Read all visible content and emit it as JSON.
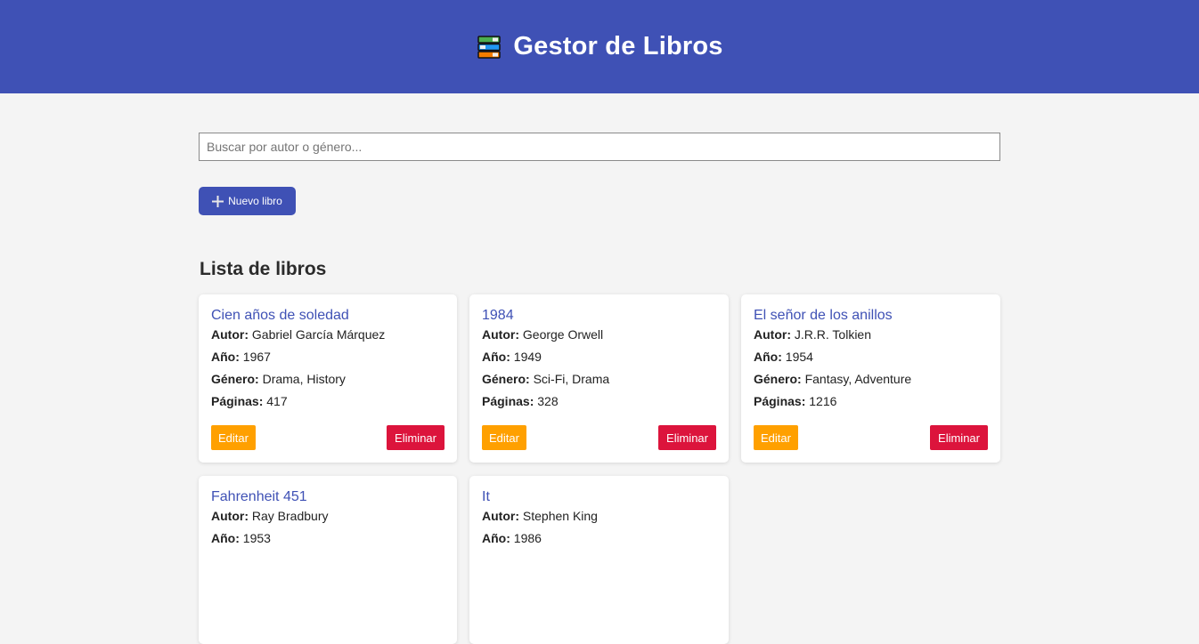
{
  "header": {
    "icon": "books-icon",
    "title": "Gestor de Libros"
  },
  "search": {
    "placeholder": "Buscar por autor o género...",
    "value": ""
  },
  "new_book_button": {
    "icon": "plus-icon",
    "label": "Nuevo libro"
  },
  "list_title": "Lista de libros",
  "labels": {
    "author": "Autor:",
    "year": "Año:",
    "genre": "Género:",
    "pages": "Páginas:",
    "edit": "Editar",
    "delete": "Eliminar"
  },
  "books": [
    {
      "title": "Cien años de soledad",
      "author": "Gabriel García Márquez",
      "year": "1967",
      "genre": "Drama, History",
      "pages": "417"
    },
    {
      "title": "1984",
      "author": "George Orwell",
      "year": "1949",
      "genre": "Sci-Fi, Drama",
      "pages": "328"
    },
    {
      "title": "El señor de los anillos",
      "author": "J.R.R. Tolkien",
      "year": "1954",
      "genre": "Fantasy, Adventure",
      "pages": "1216"
    },
    {
      "title": "Fahrenheit 451",
      "author": "Ray Bradbury",
      "year": "1953",
      "genre": "",
      "pages": ""
    },
    {
      "title": "It",
      "author": "Stephen King",
      "year": "1986",
      "genre": "",
      "pages": ""
    }
  ],
  "colors": {
    "primary": "#3f51b5",
    "edit": "#ffa000",
    "delete": "#dc143c",
    "background": "#f4f4f4"
  }
}
